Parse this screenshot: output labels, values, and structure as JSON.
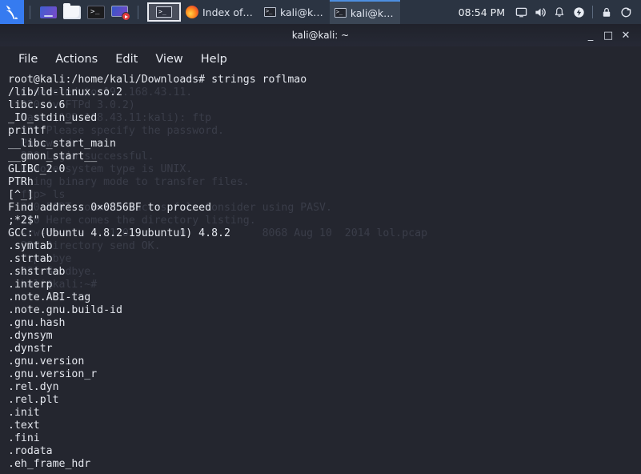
{
  "taskbar": {
    "launchers": [
      {
        "name": "kali-menu-icon",
        "label": "Kali Linux Menu"
      },
      {
        "name": "app-launcher-icon",
        "label": "Application Finder"
      },
      {
        "name": "file-manager-icon",
        "label": "File Manager"
      },
      {
        "name": "terminal-launcher-icon",
        "label": "Terminal Emulator"
      },
      {
        "name": "screen-recorder-icon",
        "label": "Screen Recorder"
      }
    ],
    "workspace": {
      "name": "workspace-indicator",
      "label": "Workspace 1"
    },
    "windows": [
      {
        "name": "window-button-firefox",
        "label": "Index of…",
        "icon": "firefox-icon",
        "active": false
      },
      {
        "name": "window-button-terminal-1",
        "label": "kali@k…",
        "icon": "terminal-icon",
        "active": false
      },
      {
        "name": "window-button-terminal-2",
        "label": "kali@k…",
        "icon": "terminal-icon",
        "active": true
      }
    ],
    "clock": "08:54 PM",
    "tray": [
      {
        "name": "display-icon",
        "label": "Display settings"
      },
      {
        "name": "volume-icon",
        "label": "Volume"
      },
      {
        "name": "notifications-bell-icon",
        "label": "Notifications"
      },
      {
        "name": "power-manager-icon",
        "label": "Power Manager"
      },
      {
        "name": "lock-screen-icon",
        "label": "Lock Screen"
      },
      {
        "name": "logout-icon",
        "label": "Log Out"
      }
    ]
  },
  "window": {
    "title": "kali@kali: ~",
    "controls": {
      "minimize": "_",
      "maximize": "□",
      "close": "✕"
    },
    "menu": [
      {
        "name": "menu-file",
        "label": "File"
      },
      {
        "name": "menu-actions",
        "label": "Actions"
      },
      {
        "name": "menu-edit",
        "label": "Edit"
      },
      {
        "name": "menu-view",
        "label": "View"
      },
      {
        "name": "menu-help",
        "label": "Help"
      }
    ]
  },
  "terminal": {
    "prompt": "root@kali:/home/kali/Downloads#",
    "command": "strings roflmao",
    "command_line": "root@kali:/home/kali/Downloads# strings roflmao",
    "output_lines": [
      "/lib/ld-linux.so.2",
      "libc.so.6",
      "_IO_stdin_used",
      "printf",
      "__libc_start_main",
      "__gmon_start__",
      "GLIBC_2.0",
      "PTRh",
      "[^_]",
      "Find address 0×0856BF to proceed",
      ";*2$\"",
      "GCC: (Ubuntu 4.8.2-19ubuntu1) 4.8.2",
      ".symtab",
      ".strtab",
      ".shstrtab",
      ".interp",
      ".note.ABI-tag",
      ".note.gnu.build-id",
      ".gnu.hash",
      ".dynsym",
      ".dynstr",
      ".gnu.version",
      ".gnu.version_r",
      ".rel.dyn",
      ".rel.plt",
      ".init",
      ".text",
      ".fini",
      ".rodata",
      ".eh_frame_hdr"
    ],
    "ghost_lines": [
      "",
      "  Connected to 192.168.43.11.",
      "  220 (vsFTPd 3.0.2)",
      "  Name (192.168.43.11:kali): ftp",
      "  331 Please specify the password.",
      "  Password:",
      "  230 Login successful.",
      "  Remote system type is UNIX.",
      "  Using binary mode to transfer files.",
      "  ftp> ls",
      "  200 PORT command successful. Consider using PASV.",
      "  150 Here comes the directory listing.",
      "  -rw-r--r--    1 0        0            8068 Aug 10  2014 lol.pcap",
      "  226 Directory send OK.",
      "  ftp> bye",
      "  221 Goodbye.",
      "  kali@kali:~# "
    ]
  },
  "colors": {
    "taskbar_bg": "#2b3442",
    "taskbar_accent": "#4d8fe0",
    "terminal_bg": "#24262f",
    "terminal_fg": "#e4e7ee",
    "ghost_fg": "#3a3d49",
    "titlebar_bg": "#262935",
    "kali_blue": "#367bf0",
    "record_red": "#e23b3b"
  }
}
